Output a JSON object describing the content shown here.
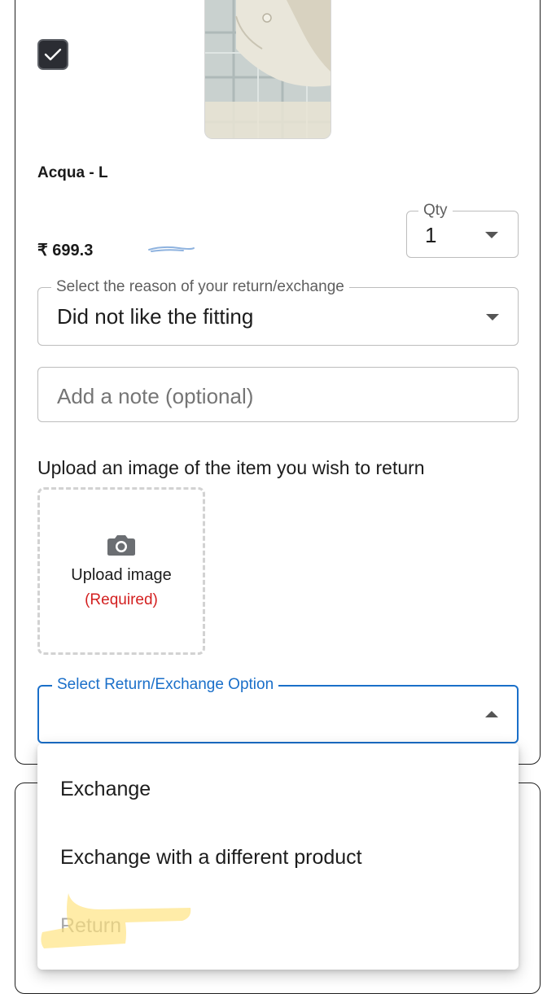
{
  "product": {
    "name": "Acqua - L",
    "price": "₹ 699.3",
    "checked": true
  },
  "qty": {
    "label": "Qty",
    "value": "1"
  },
  "reason": {
    "label": "Select the reason of your return/exchange",
    "value": "Did not like the fitting"
  },
  "note": {
    "placeholder": "Add a note (optional)"
  },
  "upload": {
    "prompt": "Upload an image of the item you wish to return",
    "button_label": "Upload image",
    "required_label": "(Required)",
    "icon": "camera-icon"
  },
  "option_select": {
    "label": "Select Return/Exchange Option",
    "value": "",
    "accent": "#1a6fc9"
  },
  "menu": {
    "items": [
      {
        "label": "Exchange",
        "disabled": false
      },
      {
        "label": "Exchange with a different product",
        "disabled": false
      },
      {
        "label": "Return",
        "disabled": true
      }
    ]
  },
  "colors": {
    "required": "#d32020",
    "highlight": "#ffe27a"
  }
}
